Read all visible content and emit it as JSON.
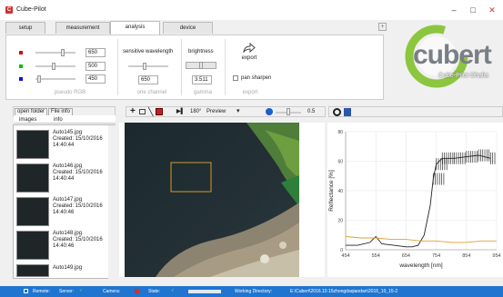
{
  "window": {
    "title": "Cube-Pilot",
    "minimize": "–",
    "maximize": "□",
    "close": "✕"
  },
  "tabs": [
    {
      "label": "setup"
    },
    {
      "label": "measurement"
    },
    {
      "label": "analysis"
    },
    {
      "label": "device"
    }
  ],
  "tab_add": "+",
  "ribbon": {
    "rgb": {
      "red": "650",
      "green": "500",
      "blue": "450",
      "label": "pseudo RGB",
      "colors": {
        "red": "#e00000",
        "green": "#00c000",
        "blue": "#1010e0"
      }
    },
    "channel": {
      "title": "sensitive wavelength",
      "value": "650",
      "label": "one channel"
    },
    "gamma": {
      "title": "brightness",
      "value": "3.511",
      "label": "gamma"
    },
    "export": {
      "button": "export",
      "pan_sharpen": "pan sharpen",
      "label": "export"
    }
  },
  "logo": {
    "text": "cubert",
    "subtitle": "Cube-Pilot Ohalia",
    "colors": {
      "ring": "#8cc63f",
      "body": "#7a7f86"
    }
  },
  "left_panel": {
    "open_folder": "open folder",
    "file_info": "File info",
    "columns": [
      "images",
      "info"
    ],
    "files": [
      {
        "name": "Auto145.jpg",
        "created": "Created: 15/10/2016",
        "time": "14:40:44"
      },
      {
        "name": "Auto146.jpg",
        "created": "Created: 15/10/2016",
        "time": "14:40:44"
      },
      {
        "name": "Auto147.jpg",
        "created": "Created: 15/10/2016",
        "time": "14:40:46"
      },
      {
        "name": "Auto148.jpg",
        "created": "Created: 15/10/2016",
        "time": "14:40:46"
      },
      {
        "name": "Auto149.jpg",
        "created": "",
        "time": ""
      }
    ]
  },
  "image_toolbar": {
    "rotation": "180°",
    "preview": "Preview",
    "zoom": "0.5"
  },
  "chart_data": {
    "type": "line",
    "xlabel": "wavelength [nm]",
    "ylabel": "Reflectance [%]",
    "xlim": [
      454,
      954
    ],
    "ylim": [
      0,
      80
    ],
    "x_ticks": [
      454,
      554,
      654,
      754,
      854,
      954
    ],
    "y_ticks": [
      0,
      20,
      40,
      60,
      80
    ],
    "grid": true,
    "series": [
      {
        "color": "#222222",
        "errorbars": true,
        "x": [
          454,
          494,
          534,
          554,
          574,
          614,
          654,
          674,
          694,
          714,
          734,
          744,
          754,
          774,
          814,
          854,
          894,
          934
        ],
        "y": [
          3,
          3,
          5,
          9,
          4,
          3,
          2,
          2,
          3,
          10,
          30,
          48,
          58,
          62,
          62,
          63,
          64,
          62
        ]
      },
      {
        "color": "#e0a030",
        "x": [
          454,
          504,
          554,
          604,
          654,
          704,
          754,
          804,
          854,
          904,
          954
        ],
        "y": [
          9,
          8,
          8,
          7,
          7,
          6,
          6,
          5,
          5,
          6,
          6
        ]
      }
    ]
  },
  "status": {
    "remote": "Remote:",
    "server": "Server:",
    "camera": "Camera:",
    "state": "State:",
    "working_dir_label": "Working Directory:",
    "working_dir": "E:\\Cubert\\2016.10.15zhongdaqiaodan\\2016_10_15-2"
  }
}
